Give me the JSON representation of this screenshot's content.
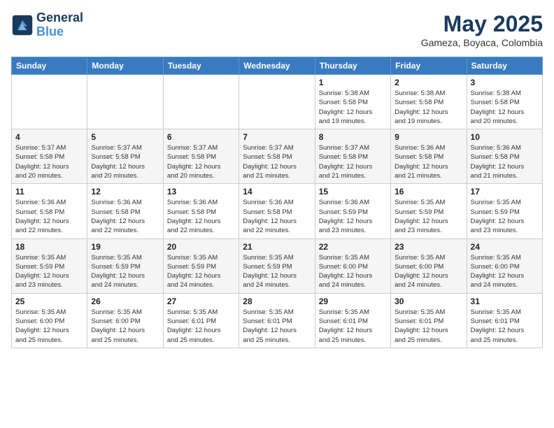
{
  "header": {
    "logo_line1": "General",
    "logo_line2": "Blue",
    "month": "May 2025",
    "location": "Gameza, Boyaca, Colombia"
  },
  "weekdays": [
    "Sunday",
    "Monday",
    "Tuesday",
    "Wednesday",
    "Thursday",
    "Friday",
    "Saturday"
  ],
  "weeks": [
    [
      {
        "day": "",
        "info": ""
      },
      {
        "day": "",
        "info": ""
      },
      {
        "day": "",
        "info": ""
      },
      {
        "day": "",
        "info": ""
      },
      {
        "day": "1",
        "info": "Sunrise: 5:38 AM\nSunset: 5:58 PM\nDaylight: 12 hours\nand 19 minutes."
      },
      {
        "day": "2",
        "info": "Sunrise: 5:38 AM\nSunset: 5:58 PM\nDaylight: 12 hours\nand 19 minutes."
      },
      {
        "day": "3",
        "info": "Sunrise: 5:38 AM\nSunset: 5:58 PM\nDaylight: 12 hours\nand 20 minutes."
      }
    ],
    [
      {
        "day": "4",
        "info": "Sunrise: 5:37 AM\nSunset: 5:58 PM\nDaylight: 12 hours\nand 20 minutes."
      },
      {
        "day": "5",
        "info": "Sunrise: 5:37 AM\nSunset: 5:58 PM\nDaylight: 12 hours\nand 20 minutes."
      },
      {
        "day": "6",
        "info": "Sunrise: 5:37 AM\nSunset: 5:58 PM\nDaylight: 12 hours\nand 20 minutes."
      },
      {
        "day": "7",
        "info": "Sunrise: 5:37 AM\nSunset: 5:58 PM\nDaylight: 12 hours\nand 21 minutes."
      },
      {
        "day": "8",
        "info": "Sunrise: 5:37 AM\nSunset: 5:58 PM\nDaylight: 12 hours\nand 21 minutes."
      },
      {
        "day": "9",
        "info": "Sunrise: 5:36 AM\nSunset: 5:58 PM\nDaylight: 12 hours\nand 21 minutes."
      },
      {
        "day": "10",
        "info": "Sunrise: 5:36 AM\nSunset: 5:58 PM\nDaylight: 12 hours\nand 21 minutes."
      }
    ],
    [
      {
        "day": "11",
        "info": "Sunrise: 5:36 AM\nSunset: 5:58 PM\nDaylight: 12 hours\nand 22 minutes."
      },
      {
        "day": "12",
        "info": "Sunrise: 5:36 AM\nSunset: 5:58 PM\nDaylight: 12 hours\nand 22 minutes."
      },
      {
        "day": "13",
        "info": "Sunrise: 5:36 AM\nSunset: 5:58 PM\nDaylight: 12 hours\nand 22 minutes."
      },
      {
        "day": "14",
        "info": "Sunrise: 5:36 AM\nSunset: 5:58 PM\nDaylight: 12 hours\nand 22 minutes."
      },
      {
        "day": "15",
        "info": "Sunrise: 5:36 AM\nSunset: 5:59 PM\nDaylight: 12 hours\nand 23 minutes."
      },
      {
        "day": "16",
        "info": "Sunrise: 5:35 AM\nSunset: 5:59 PM\nDaylight: 12 hours\nand 23 minutes."
      },
      {
        "day": "17",
        "info": "Sunrise: 5:35 AM\nSunset: 5:59 PM\nDaylight: 12 hours\nand 23 minutes."
      }
    ],
    [
      {
        "day": "18",
        "info": "Sunrise: 5:35 AM\nSunset: 5:59 PM\nDaylight: 12 hours\nand 23 minutes."
      },
      {
        "day": "19",
        "info": "Sunrise: 5:35 AM\nSunset: 5:59 PM\nDaylight: 12 hours\nand 24 minutes."
      },
      {
        "day": "20",
        "info": "Sunrise: 5:35 AM\nSunset: 5:59 PM\nDaylight: 12 hours\nand 24 minutes."
      },
      {
        "day": "21",
        "info": "Sunrise: 5:35 AM\nSunset: 5:59 PM\nDaylight: 12 hours\nand 24 minutes."
      },
      {
        "day": "22",
        "info": "Sunrise: 5:35 AM\nSunset: 6:00 PM\nDaylight: 12 hours\nand 24 minutes."
      },
      {
        "day": "23",
        "info": "Sunrise: 5:35 AM\nSunset: 6:00 PM\nDaylight: 12 hours\nand 24 minutes."
      },
      {
        "day": "24",
        "info": "Sunrise: 5:35 AM\nSunset: 6:00 PM\nDaylight: 12 hours\nand 24 minutes."
      }
    ],
    [
      {
        "day": "25",
        "info": "Sunrise: 5:35 AM\nSunset: 6:00 PM\nDaylight: 12 hours\nand 25 minutes."
      },
      {
        "day": "26",
        "info": "Sunrise: 5:35 AM\nSunset: 6:00 PM\nDaylight: 12 hours\nand 25 minutes."
      },
      {
        "day": "27",
        "info": "Sunrise: 5:35 AM\nSunset: 6:01 PM\nDaylight: 12 hours\nand 25 minutes."
      },
      {
        "day": "28",
        "info": "Sunrise: 5:35 AM\nSunset: 6:01 PM\nDaylight: 12 hours\nand 25 minutes."
      },
      {
        "day": "29",
        "info": "Sunrise: 5:35 AM\nSunset: 6:01 PM\nDaylight: 12 hours\nand 25 minutes."
      },
      {
        "day": "30",
        "info": "Sunrise: 5:35 AM\nSunset: 6:01 PM\nDaylight: 12 hours\nand 25 minutes."
      },
      {
        "day": "31",
        "info": "Sunrise: 5:35 AM\nSunset: 6:01 PM\nDaylight: 12 hours\nand 25 minutes."
      }
    ]
  ]
}
